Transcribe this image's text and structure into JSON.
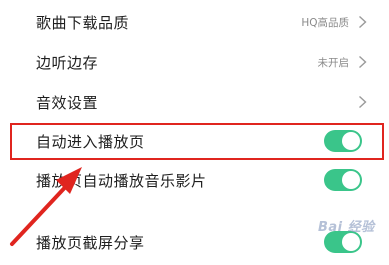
{
  "settings": {
    "items": [
      {
        "label": "歌曲下载品质",
        "value": "HQ高品质",
        "control": "chevron"
      },
      {
        "label": "边听边存",
        "value": "未开启",
        "control": "chevron"
      },
      {
        "label": "音效设置",
        "value": "",
        "control": "chevron"
      },
      {
        "label": "自动进入播放页",
        "value": "",
        "control": "toggle",
        "state": "on"
      },
      {
        "label": "播放页自动播放音乐影片",
        "value": "",
        "control": "toggle",
        "state": "on"
      },
      {
        "label": "播放页截屏分享",
        "value": "",
        "control": "toggle",
        "state": "on"
      }
    ]
  },
  "annotation": {
    "highlight_color": "#e0251f",
    "highlighted_item": "自动进入播放页"
  },
  "watermark": {
    "text": "Bai 经验"
  },
  "colors": {
    "toggle_on": "#3ac58a",
    "label_text": "#1f1f1f",
    "value_text": "#8a8a8a"
  }
}
